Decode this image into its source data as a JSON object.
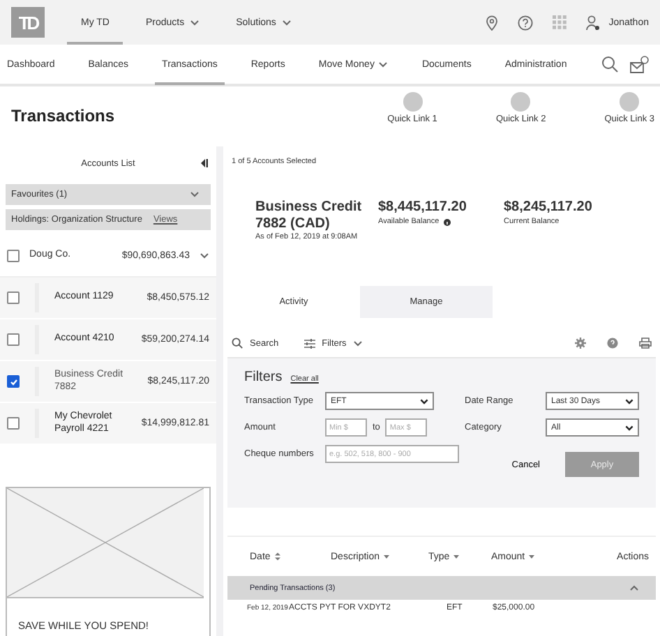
{
  "top_bar": {
    "logo": "TD",
    "tabs": [
      {
        "label": "My TD",
        "selected": true,
        "dropdown": false
      },
      {
        "label": "Products",
        "selected": false,
        "dropdown": true
      },
      {
        "label": "Solutions",
        "selected": false,
        "dropdown": true
      }
    ],
    "user": "Jonathon"
  },
  "nav": {
    "items": [
      {
        "label": "Dashboard",
        "selected": false,
        "dropdown": false
      },
      {
        "label": "Balances",
        "selected": false,
        "dropdown": false
      },
      {
        "label": "Transactions",
        "selected": true,
        "dropdown": false
      },
      {
        "label": "Reports",
        "selected": false,
        "dropdown": false
      },
      {
        "label": "Move Money",
        "selected": false,
        "dropdown": true
      },
      {
        "label": "Documents",
        "selected": false,
        "dropdown": false
      },
      {
        "label": "Administration",
        "selected": false,
        "dropdown": false
      }
    ]
  },
  "page": {
    "title": "Transactions",
    "quick_links": [
      "Quick Link 1",
      "Quick Link 2",
      "Quick Link 3"
    ]
  },
  "sidebar": {
    "title": "Accounts List",
    "favourites": "Favourites (1)",
    "holdings": "Holdings: Organization Structure",
    "views_link": "Views",
    "group": {
      "name": "Doug Co.",
      "amount": "$90,690,863.43",
      "checked": false,
      "expanded": true
    },
    "accounts": [
      {
        "name": "Account 1129",
        "amount": "$8,450,575.12",
        "checked": false
      },
      {
        "name": "Account 4210",
        "amount": "$59,200,274.14",
        "checked": false
      },
      {
        "name": "Business Credit 7882",
        "amount": "$8,245,117.20",
        "checked": true
      },
      {
        "name": "My Chevrolet Payroll 4221",
        "amount": "$14,999,812.81",
        "checked": false
      }
    ],
    "promo": "SAVE WHILE YOU SPEND!"
  },
  "account": {
    "selection": "1 of 5 Accounts Selected",
    "name": "Business Credit 7882 (CAD)",
    "as_of": "As of Feb 12, 2019 at 9:08AM",
    "balances": [
      {
        "amount": "$8,445,117.20",
        "label": "Available Balance",
        "info": true
      },
      {
        "amount": "$8,245,117.20",
        "label": "Current Balance",
        "info": false
      }
    ]
  },
  "tabs": [
    {
      "label": "Activity",
      "selected": true
    },
    {
      "label": "Manage",
      "selected": false
    }
  ],
  "toolbar": {
    "search": "Search",
    "filters": "Filters"
  },
  "filters": {
    "title": "Filters",
    "clear": "Clear all",
    "transaction_type": {
      "label": "Transaction Type",
      "value": "EFT"
    },
    "date_range": {
      "label": "Date Range",
      "value": "Last 30 Days"
    },
    "amount": {
      "label": "Amount",
      "min_placeholder": "Min $",
      "to": "to",
      "max_placeholder": "Max $"
    },
    "category": {
      "label": "Category",
      "value": "All"
    },
    "cheque": {
      "label": "Cheque numbers",
      "placeholder": "e.g. 502, 518, 800 - 900"
    },
    "cancel": "Cancel",
    "apply": "Apply"
  },
  "table": {
    "columns": [
      {
        "label": "Date",
        "kind": "both"
      },
      {
        "label": "Description",
        "kind": "down"
      },
      {
        "label": "Type",
        "kind": "down"
      },
      {
        "label": "Amount",
        "kind": "down"
      },
      {
        "label": "Actions",
        "kind": "plain"
      }
    ],
    "groups": [
      {
        "title": "Pending Transactions (3)",
        "expanded": true,
        "rows": [
          {
            "date": "Feb 12, 2019",
            "description": "ACCTS PYT FOR VXDYT2",
            "type": "EFT",
            "amount": "$25,000.00"
          }
        ]
      }
    ]
  }
}
